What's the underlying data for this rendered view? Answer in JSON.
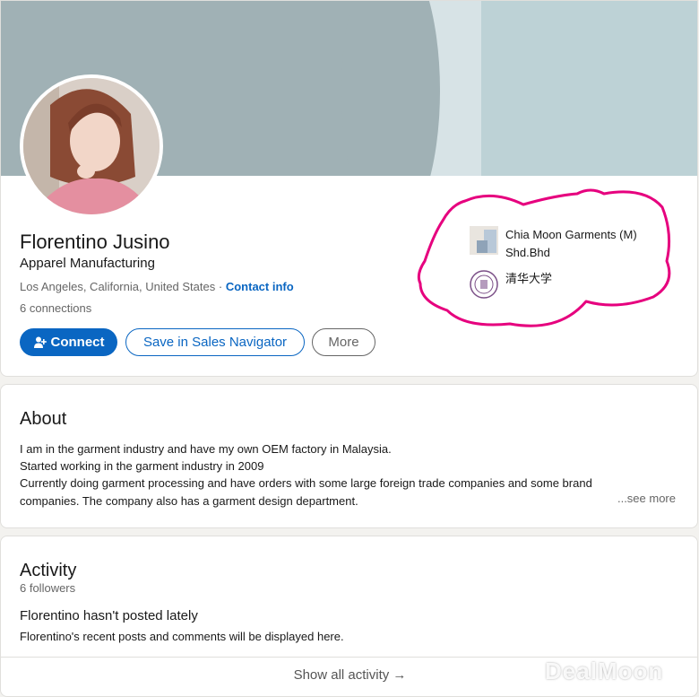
{
  "profile": {
    "name": "Florentino Jusino",
    "headline": "Apparel Manufacturing",
    "location": "Los Angeles, California, United States",
    "separator": "·",
    "contact_info": "Contact info",
    "connections": "6 connections"
  },
  "actions": {
    "connect": "Connect",
    "sales_navigator": "Save in Sales Navigator",
    "more": "More"
  },
  "organizations": [
    {
      "name": "Chia Moon Garments (M) Shd.Bhd",
      "icon": "company-logo-icon"
    },
    {
      "name": "清华大学",
      "icon": "university-logo-icon"
    }
  ],
  "about": {
    "title": "About",
    "lines": [
      "I am in the garment industry and have my own OEM factory in Malaysia.",
      "Started working in the garment industry in 2009",
      "Currently doing garment processing and have orders with some large foreign trade companies and some brand",
      "companies. The company also has a garment design department."
    ],
    "see_more": "...see more"
  },
  "activity": {
    "title": "Activity",
    "followers": "6 followers",
    "empty_title": "Florentino hasn't posted lately",
    "empty_sub": "Florentino's recent posts and comments will be displayed here.",
    "show_all": "Show all activity →"
  },
  "watermark": "DealMoon",
  "colors": {
    "accent": "#0a66c2",
    "highlight": "#e6007e"
  }
}
